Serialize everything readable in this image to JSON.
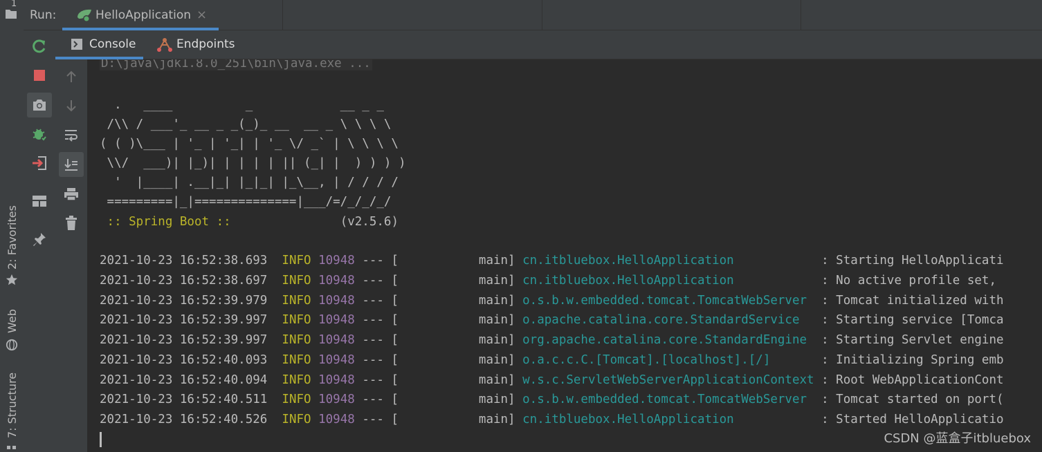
{
  "window": {
    "run_label": "Run:",
    "run_tab": "HelloApplication",
    "close_glyph": "×"
  },
  "subtabs": {
    "console": "Console",
    "endpoints": "Endpoints"
  },
  "sidebar": {
    "favorites": "2: Favorites",
    "web": "Web",
    "structure": "7: Structure",
    "top_number": "1"
  },
  "console": {
    "command": "D:\\java\\jdk1.8.0_251\\bin\\java.exe ...",
    "banner": [
      "  .   ____          _            __ _ _",
      " /\\\\ / ___'_ __ _ _(_)_ __  __ _ \\ \\ \\ \\",
      "( ( )\\___ | '_ | '_| | '_ \\/ _` | \\ \\ \\ \\",
      " \\\\/  ___)| |_)| | | | | || (_| |  ) ) ) )",
      "  '  |____| .__|_| |_|_| |_\\__, | / / / /",
      " =========|_|==============|___/=/_/_/_/"
    ],
    "boot_label": " :: Spring Boot :: ",
    "boot_version": "              (v2.5.6)",
    "logs": [
      {
        "ts": "2021-10-23 16:52:38.693",
        "level": "INFO",
        "pid": "10948",
        "sep": " --- [",
        "thread": "           main] ",
        "logger": "cn.itbluebox.HelloApplication           ",
        "msg": " : Starting HelloApplicati"
      },
      {
        "ts": "2021-10-23 16:52:38.697",
        "level": "INFO",
        "pid": "10948",
        "sep": " --- [",
        "thread": "           main] ",
        "logger": "cn.itbluebox.HelloApplication           ",
        "msg": " : No active profile set, "
      },
      {
        "ts": "2021-10-23 16:52:39.979",
        "level": "INFO",
        "pid": "10948",
        "sep": " --- [",
        "thread": "           main] ",
        "logger": "o.s.b.w.embedded.tomcat.TomcatWebServer ",
        "msg": " : Tomcat initialized with"
      },
      {
        "ts": "2021-10-23 16:52:39.997",
        "level": "INFO",
        "pid": "10948",
        "sep": " --- [",
        "thread": "           main] ",
        "logger": "o.apache.catalina.core.StandardService  ",
        "msg": " : Starting service [Tomca"
      },
      {
        "ts": "2021-10-23 16:52:39.997",
        "level": "INFO",
        "pid": "10948",
        "sep": " --- [",
        "thread": "           main] ",
        "logger": "org.apache.catalina.core.StandardEngine ",
        "msg": " : Starting Servlet engine"
      },
      {
        "ts": "2021-10-23 16:52:40.093",
        "level": "INFO",
        "pid": "10948",
        "sep": " --- [",
        "thread": "           main] ",
        "logger": "o.a.c.c.C.[Tomcat].[localhost].[/]      ",
        "msg": " : Initializing Spring emb"
      },
      {
        "ts": "2021-10-23 16:52:40.094",
        "level": "INFO",
        "pid": "10948",
        "sep": " --- [",
        "thread": "           main] ",
        "logger": "w.s.c.ServletWebServerApplicationContext",
        "msg": " : Root WebApplicationCont"
      },
      {
        "ts": "2021-10-23 16:52:40.511",
        "level": "INFO",
        "pid": "10948",
        "sep": " --- [",
        "thread": "           main] ",
        "logger": "o.s.b.w.embedded.tomcat.TomcatWebServer ",
        "msg": " : Tomcat started on port("
      },
      {
        "ts": "2021-10-23 16:52:40.526",
        "level": "INFO",
        "pid": "10948",
        "sep": " --- [",
        "thread": "           main] ",
        "logger": "cn.itbluebox.HelloApplication           ",
        "msg": " : Started HelloApplicatio"
      }
    ]
  },
  "watermark": "CSDN @蓝盒子itbluebox",
  "colors": {
    "accent": "#4a88c7",
    "info": "#bbb529",
    "pid": "#9876aa",
    "logger": "#299999",
    "rerun": "#59a869",
    "stop": "#db5c5c"
  },
  "icons": [
    "rerun-icon",
    "stop-icon",
    "camera-icon",
    "debug-bug-icon",
    "exit-icon",
    "layout-icon",
    "pin-icon",
    "console-icon",
    "endpoints-icon",
    "up-arrow-icon",
    "down-arrow-icon",
    "soft-wrap-icon",
    "scroll-to-end-icon",
    "print-icon",
    "trash-icon",
    "star-icon",
    "globe-icon",
    "structure-icon",
    "folder-icon"
  ]
}
